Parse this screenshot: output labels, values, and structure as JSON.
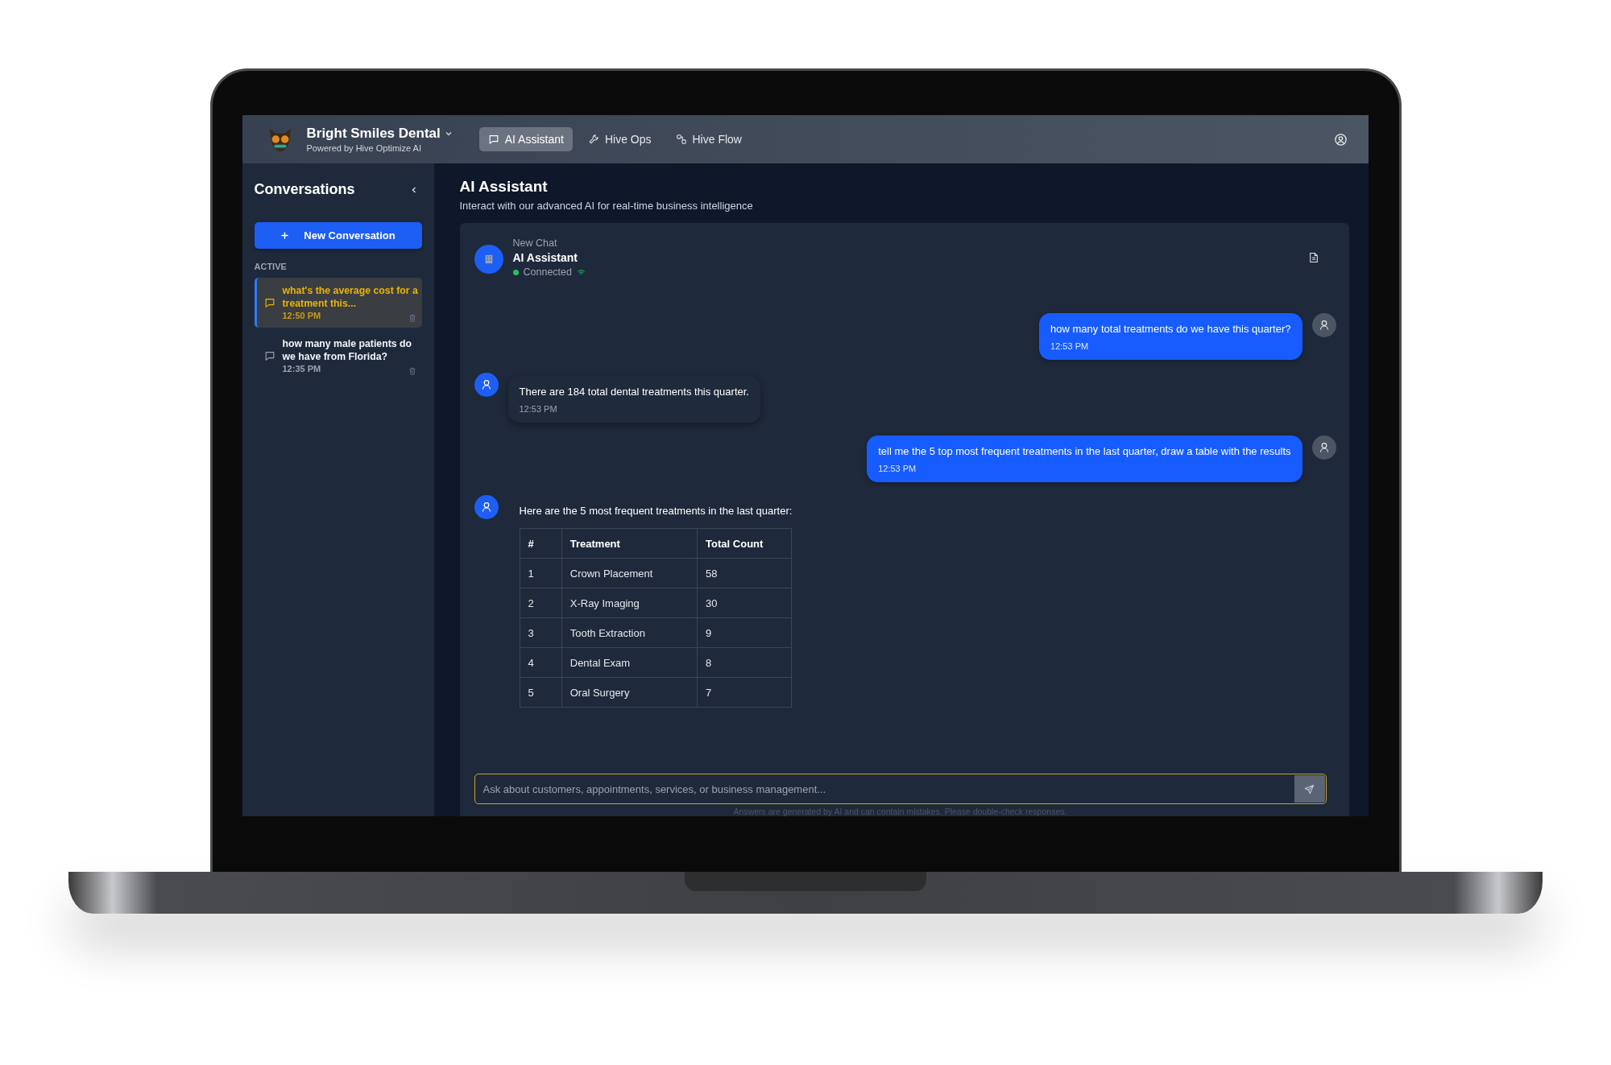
{
  "app": {
    "name": "Bright Smiles Dental",
    "subtitle": "Powered by Hive Optimize AI"
  },
  "nav": [
    {
      "label": "AI Assistant",
      "kind": "chat",
      "selected": true
    },
    {
      "label": "Hive Ops",
      "kind": "tools",
      "selected": false
    },
    {
      "label": "Hive Flow",
      "kind": "flow",
      "selected": false
    }
  ],
  "sidebar": {
    "title": "Conversations",
    "new_button": "New Conversation",
    "section": "ACTIVE",
    "conversations": [
      {
        "title": "what's the average cost for a treatment this...",
        "time": "12:50 PM",
        "selected": true
      },
      {
        "title": "how many male patients do we have from Florida?",
        "time": "12:35 PM",
        "selected": false
      }
    ]
  },
  "page": {
    "title": "AI Assistant",
    "subtitle": "Interact with our advanced AI for real-time business intelligence"
  },
  "chat": {
    "label": "New Chat",
    "name": "AI Assistant",
    "status": "Connected",
    "connected": true,
    "messages": [
      {
        "kind": "user",
        "text": "how many total treatments do we have this quarter?",
        "time": "12:53 PM"
      },
      {
        "kind": "assistant",
        "text": "There are 184 total dental treatments this quarter.",
        "time": "12:53 PM"
      },
      {
        "kind": "user",
        "text": "tell me the 5 top most frequent treatments in the last quarter, draw a table with the results",
        "time": "12:53 PM"
      },
      {
        "kind": "assistant",
        "text": "Here are the 5 most frequent treatments in the last quarter:",
        "table": {
          "columns": [
            "#",
            "Treatment",
            "Total Count"
          ],
          "rows": [
            [
              "1",
              "Crown Placement",
              "58"
            ],
            [
              "2",
              "X-Ray Imaging",
              "30"
            ],
            [
              "3",
              "Tooth Extraction",
              "9"
            ],
            [
              "4",
              "Dental Exam",
              "8"
            ],
            [
              "5",
              "Oral Surgery",
              "7"
            ]
          ]
        }
      }
    ]
  },
  "composer": {
    "placeholder": "Ask about customers, appointments, services, or business management...",
    "note": "Answers are generated by AI and can contain mistakes. Please double-check responses."
  }
}
